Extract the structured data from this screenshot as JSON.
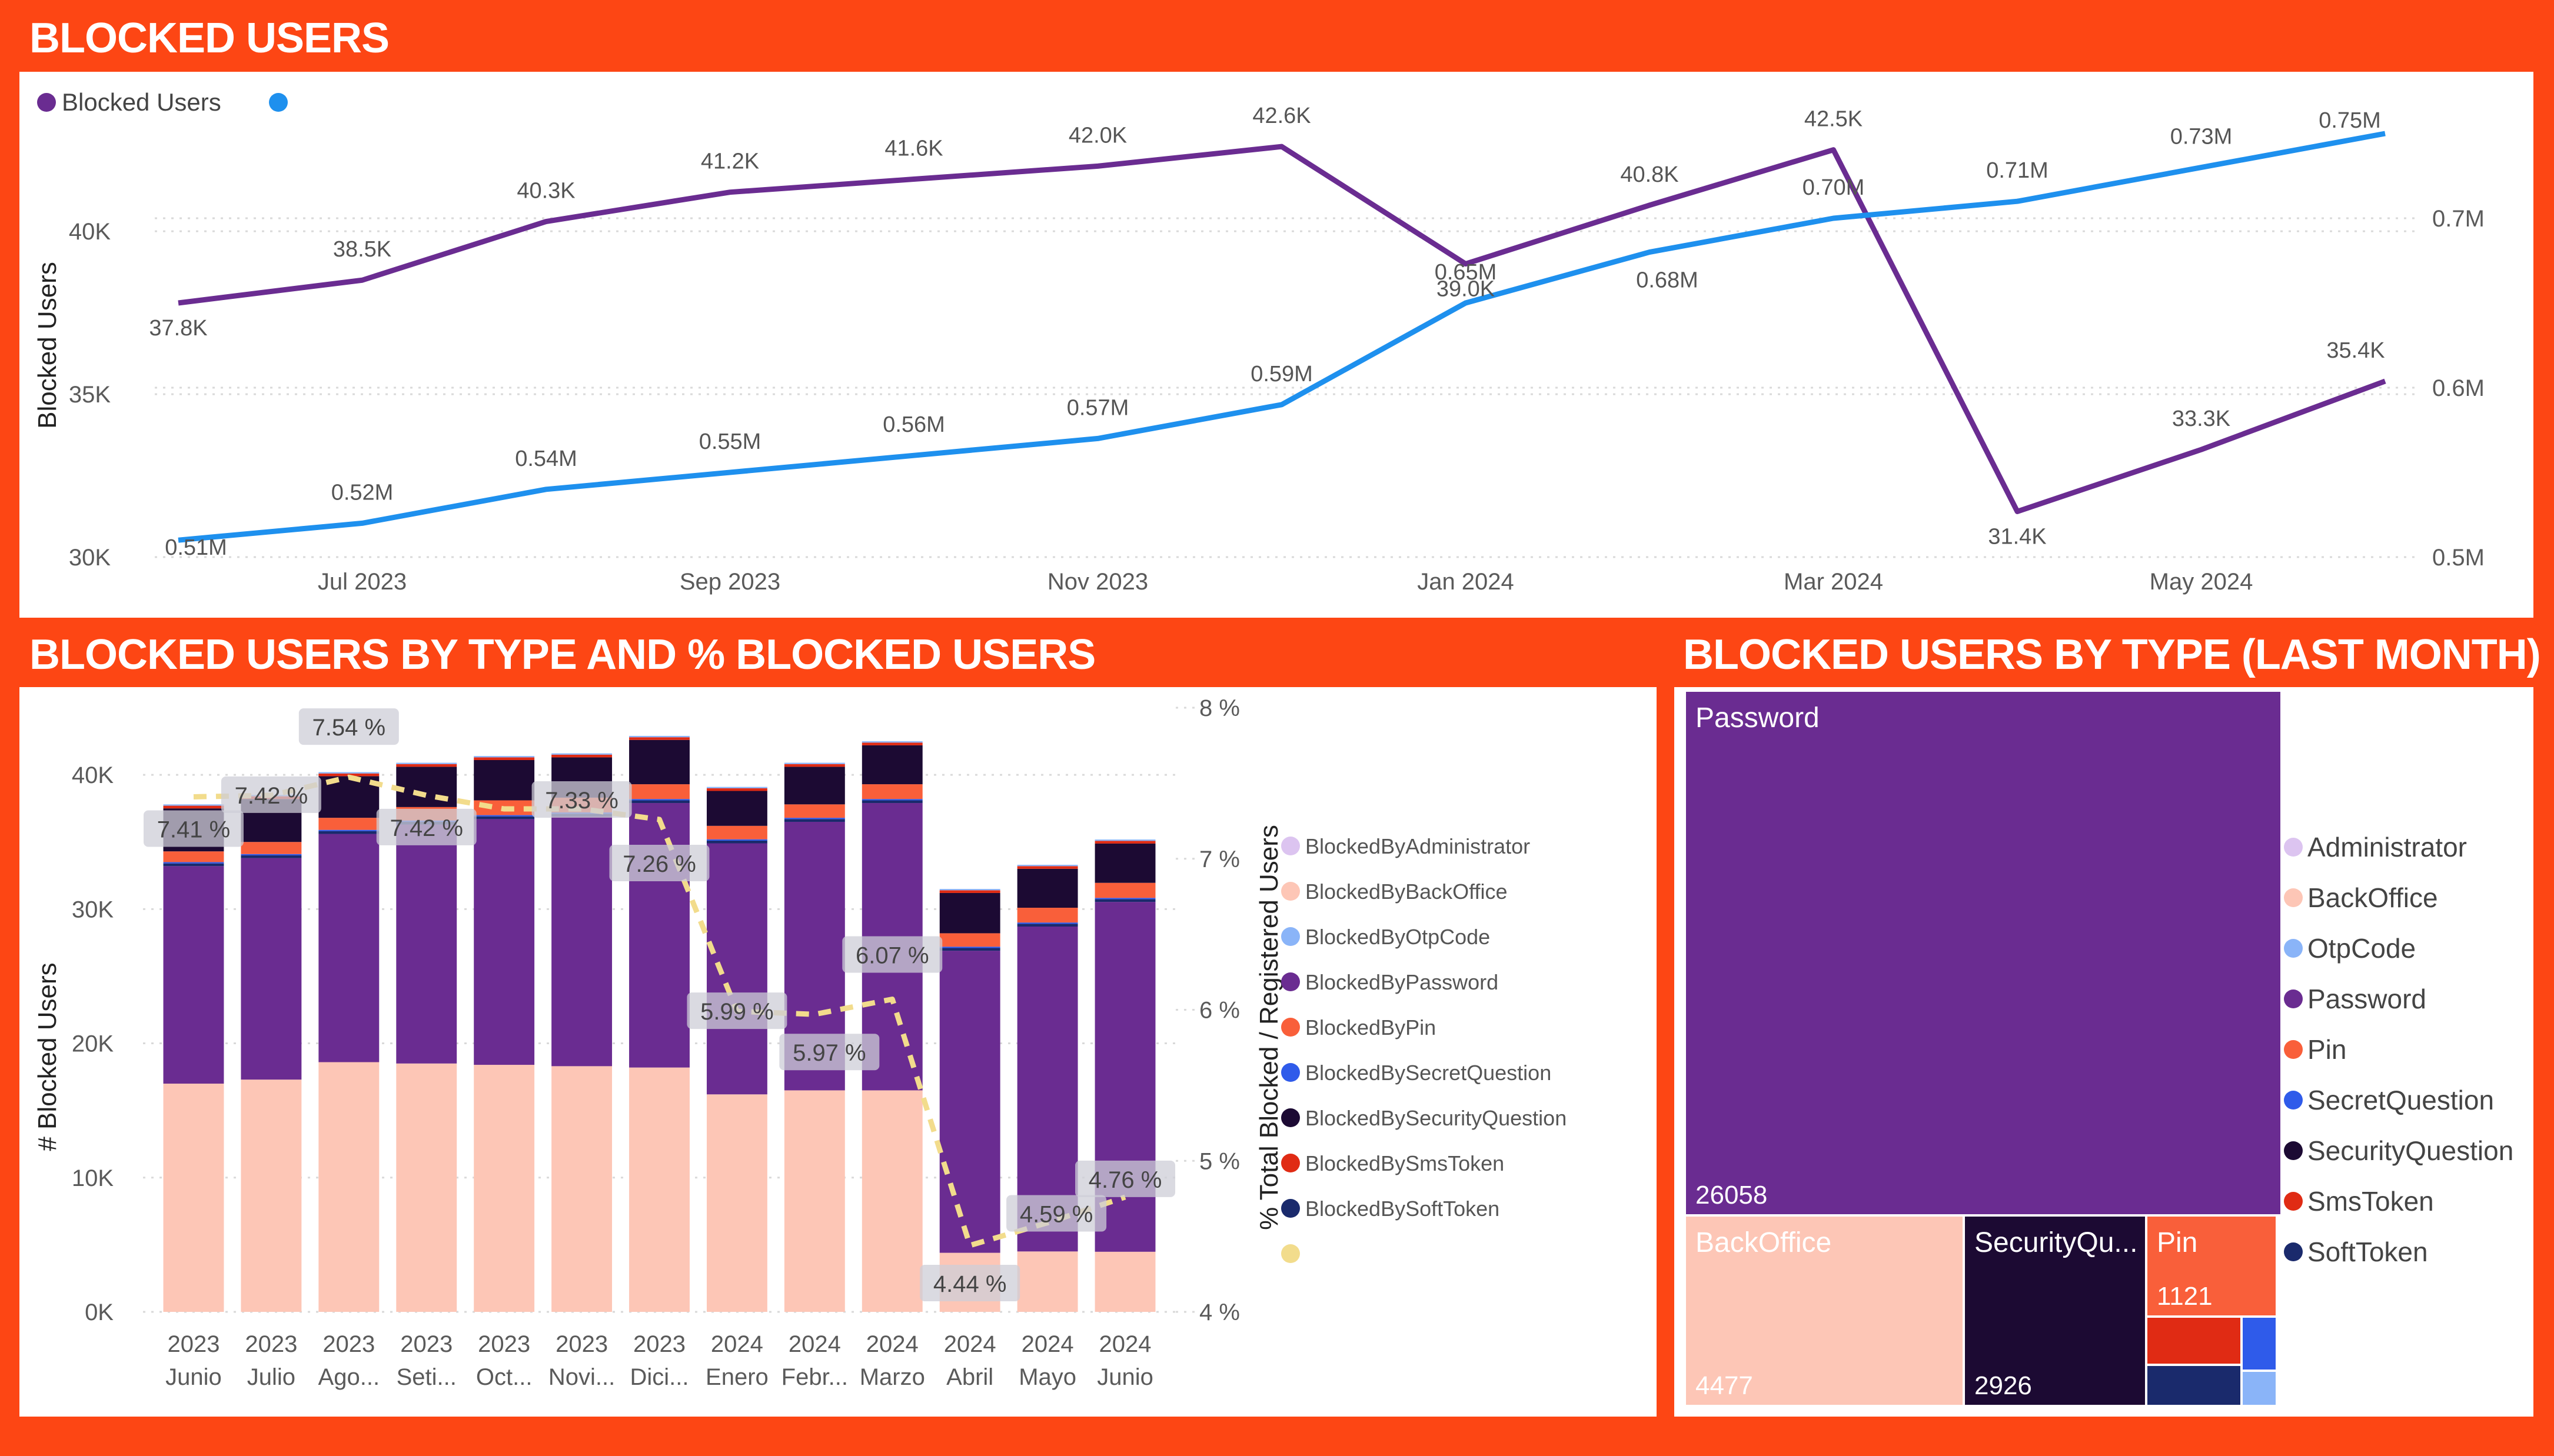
{
  "panels": {
    "line_title": "BLOCKED USERS",
    "bar_title": "BLOCKED USERS BY TYPE AND % BLOCKED USERS",
    "tree_title": "BLOCKED USERS BY TYPE (LAST MONTH)"
  },
  "colors": {
    "accent": "#fd4614",
    "blocked_users": "#6a2c91",
    "registered_line": "#1e90ee",
    "percent_line": "#f2dc8c",
    "grid": "#d9d9d9",
    "axis_text": "#5a5a5a"
  },
  "chart_data": [
    {
      "type": "line",
      "title": "BLOCKED USERS",
      "ylabel": "Blocked Users",
      "ylim": [
        30000,
        43000
      ],
      "y2lim": [
        0.5,
        0.75
      ],
      "x": [
        "Jun 2023",
        "Jul 2023",
        "Aug 2023",
        "Sep 2023",
        "Oct 2023",
        "Nov 2023",
        "Dec 2023",
        "Jan 2024",
        "Feb 2024",
        "Mar 2024",
        "Apr 2024",
        "May 2024",
        "Jun 2024"
      ],
      "x_tick_labels": [
        {
          "index": 1,
          "label": "Jul 2023"
        },
        {
          "index": 3,
          "label": "Sep 2023"
        },
        {
          "index": 5,
          "label": "Nov 2023"
        },
        {
          "index": 7,
          "label": "Jan 2024"
        },
        {
          "index": 9,
          "label": "Mar 2024"
        },
        {
          "index": 11,
          "label": "May 2024"
        }
      ],
      "y_ticks": [
        {
          "value": 30000,
          "label": "30K"
        },
        {
          "value": 35000,
          "label": "35K"
        },
        {
          "value": 40000,
          "label": "40K"
        }
      ],
      "y2_ticks": [
        {
          "value": 0.5,
          "label": "0.5M"
        },
        {
          "value": 0.6,
          "label": "0.6M"
        },
        {
          "value": 0.7,
          "label": "0.7M"
        }
      ],
      "legend": {
        "position": "top-left",
        "items": [
          {
            "name": "Blocked Users",
            "color": "#6a2c91"
          },
          {
            "name": "",
            "color": "#1e90ee"
          }
        ]
      },
      "series": [
        {
          "name": "Blocked Users",
          "axis": "left",
          "color": "#6a2c91",
          "values": [
            37800,
            38500,
            40300,
            41200,
            41600,
            42000,
            42600,
            39000,
            40800,
            42500,
            31400,
            33300,
            35400
          ],
          "labels": [
            "37.8K",
            "38.5K",
            "40.3K",
            "41.2K",
            "41.6K",
            "42.0K",
            "42.6K",
            "39.0K",
            "40.8K",
            "42.5K",
            "31.4K",
            "33.3K",
            "35.4K"
          ]
        },
        {
          "name": "",
          "axis": "right",
          "color": "#1e90ee",
          "values": [
            0.51,
            0.52,
            0.54,
            0.55,
            0.56,
            0.57,
            0.59,
            0.65,
            0.68,
            0.7,
            0.71,
            0.73,
            0.75
          ],
          "labels": [
            "0.51M",
            "0.52M",
            "0.54M",
            "0.55M",
            "0.56M",
            "0.57M",
            "0.59M",
            "0.65M",
            "0.68M",
            "0.70M",
            "0.71M",
            "0.73M",
            "0.75M"
          ]
        }
      ]
    },
    {
      "type": "bar",
      "stacked": true,
      "title": "BLOCKED USERS BY TYPE AND % BLOCKED USERS",
      "ylabel": "# Blocked Users",
      "y2label": "% Total Blocked / Registered Users",
      "ylim": [
        0,
        45000
      ],
      "y2lim": [
        4,
        8
      ],
      "y_ticks": [
        {
          "value": 0,
          "label": "0K"
        },
        {
          "value": 10000,
          "label": "10K"
        },
        {
          "value": 20000,
          "label": "20K"
        },
        {
          "value": 30000,
          "label": "30K"
        },
        {
          "value": 40000,
          "label": "40K"
        }
      ],
      "y2_ticks": [
        {
          "value": 4,
          "label": "4 %"
        },
        {
          "value": 5,
          "label": "5 %"
        },
        {
          "value": 6,
          "label": "6 %"
        },
        {
          "value": 7,
          "label": "7 %"
        },
        {
          "value": 8,
          "label": "8 %"
        }
      ],
      "categories": [
        {
          "year": "2023",
          "month": "Junio"
        },
        {
          "year": "2023",
          "month": "Julio"
        },
        {
          "year": "2023",
          "month": "Ago..."
        },
        {
          "year": "2023",
          "month": "Seti..."
        },
        {
          "year": "2023",
          "month": "Oct..."
        },
        {
          "year": "2023",
          "month": "Novi..."
        },
        {
          "year": "2023",
          "month": "Dici..."
        },
        {
          "year": "2024",
          "month": "Enero"
        },
        {
          "year": "2024",
          "month": "Febr..."
        },
        {
          "year": "2024",
          "month": "Marzo"
        },
        {
          "year": "2024",
          "month": "Abril"
        },
        {
          "year": "2024",
          "month": "Mayo"
        },
        {
          "year": "2024",
          "month": "Junio"
        }
      ],
      "series": [
        {
          "name": "BlockedByBackOffice",
          "color": "#fdc6b6",
          "values": [
            17000,
            17300,
            18600,
            18500,
            18400,
            18300,
            18200,
            16200,
            16500,
            16500,
            4400,
            4500,
            4477
          ]
        },
        {
          "name": "BlockedByPassword",
          "color": "#6a2c91",
          "values": [
            16200,
            16500,
            17000,
            17800,
            18300,
            18600,
            19700,
            18700,
            20000,
            21400,
            22500,
            24200,
            26058
          ]
        },
        {
          "name": "BlockedBySoftToken",
          "color": "#1a2a6c",
          "values": [
            200,
            200,
            200,
            200,
            200,
            200,
            200,
            200,
            200,
            200,
            200,
            200,
            200
          ]
        },
        {
          "name": "BlockedBySecretQuestion",
          "color": "#2f5bea",
          "values": [
            100,
            100,
            100,
            100,
            100,
            100,
            100,
            100,
            100,
            100,
            100,
            100,
            100
          ]
        },
        {
          "name": "BlockedByPin",
          "color": "#f95f3a",
          "values": [
            800,
            900,
            900,
            1000,
            1100,
            1100,
            1100,
            1000,
            1000,
            1100,
            1000,
            1100,
            1121
          ]
        },
        {
          "name": "BlockedBySecurityQuestion",
          "color": "#1c0a33",
          "values": [
            3200,
            3200,
            3100,
            3000,
            3000,
            3000,
            3300,
            2600,
            2800,
            2900,
            3000,
            2900,
            2926
          ]
        },
        {
          "name": "BlockedBySmsToken",
          "color": "#e02b14",
          "values": [
            200,
            200,
            200,
            200,
            200,
            200,
            200,
            200,
            200,
            200,
            200,
            200,
            200
          ]
        },
        {
          "name": "BlockedByOtpCode",
          "color": "#8ab4f8",
          "values": [
            100,
            100,
            100,
            100,
            100,
            100,
            100,
            100,
            100,
            100,
            100,
            100,
            100
          ]
        },
        {
          "name": "BlockedByAdministrator",
          "color": "#dcc4f0",
          "values": [
            0,
            0,
            0,
            0,
            0,
            0,
            0,
            0,
            0,
            0,
            0,
            0,
            0
          ]
        }
      ],
      "legend_order": [
        "BlockedByAdministrator",
        "BlockedByBackOffice",
        "BlockedByOtpCode",
        "BlockedByPassword",
        "BlockedByPin",
        "BlockedBySecretQuestion",
        "BlockedBySecurityQuestion",
        "BlockedBySmsToken",
        "BlockedBySoftToken"
      ],
      "extra_legend_color": "#f2dc8c",
      "line": {
        "axis": "right",
        "style": "dashed",
        "color": "#f2dc8c",
        "values": [
          7.41,
          7.42,
          7.54,
          7.42,
          7.33,
          7.33,
          7.26,
          5.99,
          5.97,
          6.07,
          4.44,
          4.59,
          4.76
        ],
        "labels": [
          "7.41 %",
          "7.42 %",
          "7.54 %",
          "7.42 %",
          "7.33 %",
          "7.33 %",
          "7.26 %",
          "5.99 %",
          "5.97 %",
          "6.07 %",
          "4.44 %",
          "4.59 %",
          "4.76 %"
        ],
        "shown_label_indices": [
          0,
          1,
          2,
          3,
          5,
          6,
          7,
          8,
          9,
          10,
          11,
          12
        ]
      }
    },
    {
      "type": "treemap",
      "title": "BLOCKED USERS BY TYPE (LAST MONTH)",
      "items": [
        {
          "name": "Password",
          "value": 26058,
          "color": "#6a2c91",
          "label": "Password",
          "value_label": "26058"
        },
        {
          "name": "BackOffice",
          "value": 4477,
          "color": "#fdc6b6",
          "label": "BackOffice",
          "value_label": "4477"
        },
        {
          "name": "SecurityQuestion",
          "value": 2926,
          "color": "#1c0a33",
          "label": "SecurityQu...",
          "value_label": "2926"
        },
        {
          "name": "Pin",
          "value": 1121,
          "color": "#f95f3a",
          "label": "Pin",
          "value_label": "1121"
        },
        {
          "name": "SmsToken",
          "color": "#e02b14",
          "label": "",
          "value_label": ""
        },
        {
          "name": "SecretQuestion",
          "color": "#2f5bea",
          "label": "",
          "value_label": ""
        },
        {
          "name": "SoftToken",
          "color": "#1a2a6c",
          "label": "",
          "value_label": ""
        },
        {
          "name": "OtpCode",
          "color": "#8ab4f8",
          "label": "",
          "value_label": ""
        }
      ],
      "legend": [
        {
          "name": "Administrator",
          "color": "#dcc4f0"
        },
        {
          "name": "BackOffice",
          "color": "#fdc6b6"
        },
        {
          "name": "OtpCode",
          "color": "#8ab4f8"
        },
        {
          "name": "Password",
          "color": "#6a2c91"
        },
        {
          "name": "Pin",
          "color": "#f95f3a"
        },
        {
          "name": "SecretQuestion",
          "color": "#2f5bea"
        },
        {
          "name": "SecurityQuestion",
          "color": "#1c0a33"
        },
        {
          "name": "SmsToken",
          "color": "#e02b14"
        },
        {
          "name": "SoftToken",
          "color": "#1a2a6c"
        }
      ]
    }
  ]
}
